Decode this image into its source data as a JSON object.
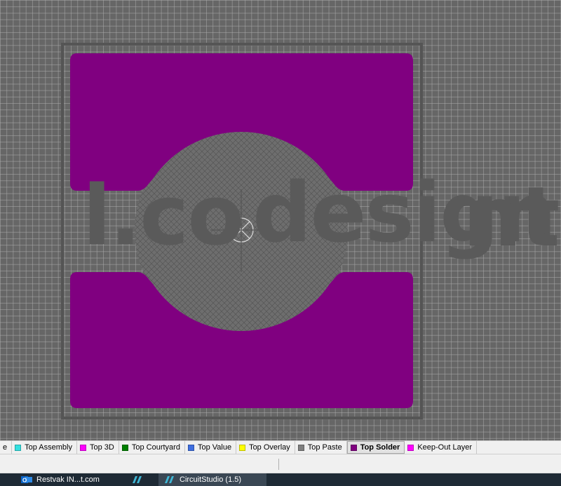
{
  "canvas": {
    "overlay_text_1": "l.co",
    "overlay_text_2": "design",
    "overlay_text_3": "nt",
    "colors": {
      "background": "#666666",
      "grid": "#aaaaaa",
      "top_solder": "#800080",
      "overlay": "#5a5a5a"
    }
  },
  "layer_tabs": [
    {
      "label": "e",
      "color": null
    },
    {
      "label": "Top Assembly",
      "color": "#33e0e0"
    },
    {
      "label": "Top 3D",
      "color": "#ff00ff"
    },
    {
      "label": "Top Courtyard",
      "color": "#008000"
    },
    {
      "label": "Top Value",
      "color": "#3f6fe0"
    },
    {
      "label": "Top Overlay",
      "color": "#ffff00"
    },
    {
      "label": "Top Paste",
      "color": "#808080"
    },
    {
      "label": "Top Solder",
      "color": "#800080",
      "active": true
    },
    {
      "label": "Keep-Out Layer",
      "color": "#ff00ff"
    }
  ],
  "taskbar": {
    "items": [
      {
        "label": "Restvak IN...t.com",
        "icon": "outlook-icon"
      },
      {
        "label": "",
        "icon": "circuitstudio-icon"
      },
      {
        "label": "CircuitStudio (1.5)",
        "icon": "circuitstudio-icon",
        "active": true
      }
    ]
  }
}
